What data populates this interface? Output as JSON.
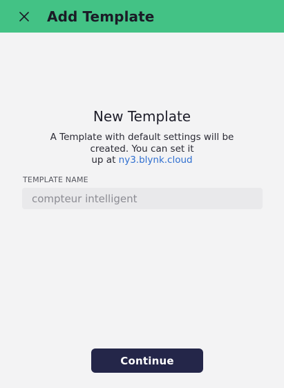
{
  "header": {
    "title": "Add Template",
    "close_icon": "close-icon"
  },
  "main": {
    "title": "New Template",
    "description_line1": "A Template with default settings will be",
    "description_line2": "created. You can set it",
    "description_line3_prefix": "up at ",
    "description_link": "ny3.blynk.cloud"
  },
  "form": {
    "name_label": "TEMPLATE NAME",
    "name_value": "compteur intelligent"
  },
  "actions": {
    "continue_label": "Continue"
  },
  "colors": {
    "header_bg": "#43c285",
    "page_bg": "#f3f3f4",
    "button_bg": "#242649",
    "link": "#2f6fd0"
  }
}
